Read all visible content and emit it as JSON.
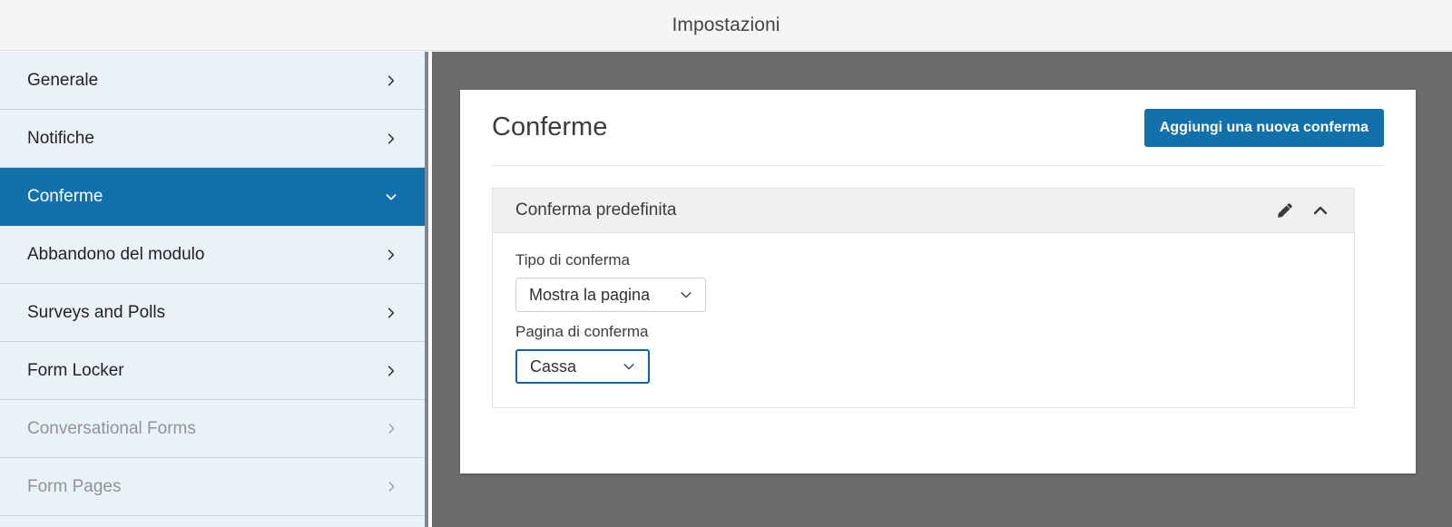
{
  "window": {
    "title": "Impostazioni"
  },
  "sidebar": {
    "items": [
      {
        "label": "Generale",
        "icon": "chevron-right-icon",
        "state": "default"
      },
      {
        "label": "Notifiche",
        "icon": "chevron-right-icon",
        "state": "default"
      },
      {
        "label": "Conferme",
        "icon": "chevron-down-icon",
        "state": "active"
      },
      {
        "label": "Abbandono del modulo",
        "icon": "chevron-right-icon",
        "state": "default"
      },
      {
        "label": "Surveys and Polls",
        "icon": "chevron-right-icon",
        "state": "default"
      },
      {
        "label": "Form Locker",
        "icon": "chevron-right-icon",
        "state": "default"
      },
      {
        "label": "Conversational Forms",
        "icon": "chevron-right-icon",
        "state": "disabled"
      },
      {
        "label": "Form Pages",
        "icon": "chevron-right-icon",
        "state": "disabled"
      }
    ]
  },
  "main": {
    "heading": "Conferme",
    "add_button_label": "Aggiungi una nuova conferma",
    "panel": {
      "title": "Conferma predefinita",
      "edit_icon": "pencil-icon",
      "collapse_icon": "chevron-up-icon",
      "fields": [
        {
          "label": "Tipo di conferma",
          "value": "Mostra la pagina",
          "icon": "chevron-down-icon",
          "focused": false
        },
        {
          "label": "Pagina di conferma",
          "value": "Cassa",
          "icon": "chevron-down-icon",
          "focused": true
        }
      ]
    }
  },
  "colors": {
    "accent_blue": "#1270ab",
    "focus_blue": "#1462a6",
    "sidebar_bg": "#eaf1f9",
    "backdrop_gray": "#6b6b6b",
    "topbar_bg": "#f5f5f5",
    "panel_head_bg": "#f0f0f0"
  }
}
